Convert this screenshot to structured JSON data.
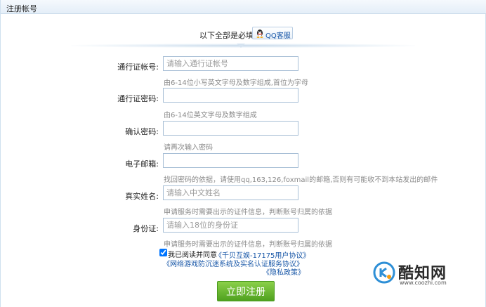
{
  "header": {
    "title": "注册帐号"
  },
  "notice": {
    "text": "以下全部是必填项",
    "qq_button": "QQ客服"
  },
  "form": {
    "fields": [
      {
        "label": "通行证帐号:",
        "placeholder": "请输入通行证帐号",
        "hint": "由6-14位小写英文字母及数字组成,首位为字母"
      },
      {
        "label": "通行证密码:",
        "placeholder": "",
        "hint": "由6-14位英文字母及数字组成"
      },
      {
        "label": "确认密码:",
        "placeholder": "",
        "hint": "请再次输入密码"
      },
      {
        "label": "电子邮箱:",
        "placeholder": "",
        "hint": "找回密码的依据，请使用qq,163,126,foxmail的邮箱,否则有可能收不到本站发出的邮件"
      },
      {
        "label": "真实姓名:",
        "placeholder": "请输入中文姓名",
        "hint": "申请服务时需要出示的证件信息，判断账号归属的依据"
      },
      {
        "label": "身份证:",
        "placeholder": "请输入18位的身份证",
        "hint": "申请服务时需要出示的证件信息，判断账号归属的依据"
      }
    ]
  },
  "agreement": {
    "checked": true,
    "text": "我已阅读并同意",
    "link1": "《千贝互娱-17175用户协议》",
    "link2": "《网络游戏防沉迷系统及实名认证服务协议》",
    "link3": "《隐私政策》"
  },
  "submit_label": "立即注册",
  "watermark": {
    "brand": "酷知网",
    "url": "www.coozhi.com"
  },
  "colors": {
    "accent": "#1a58a8",
    "button": "#5fb12a",
    "border": "#a8bfd6"
  }
}
